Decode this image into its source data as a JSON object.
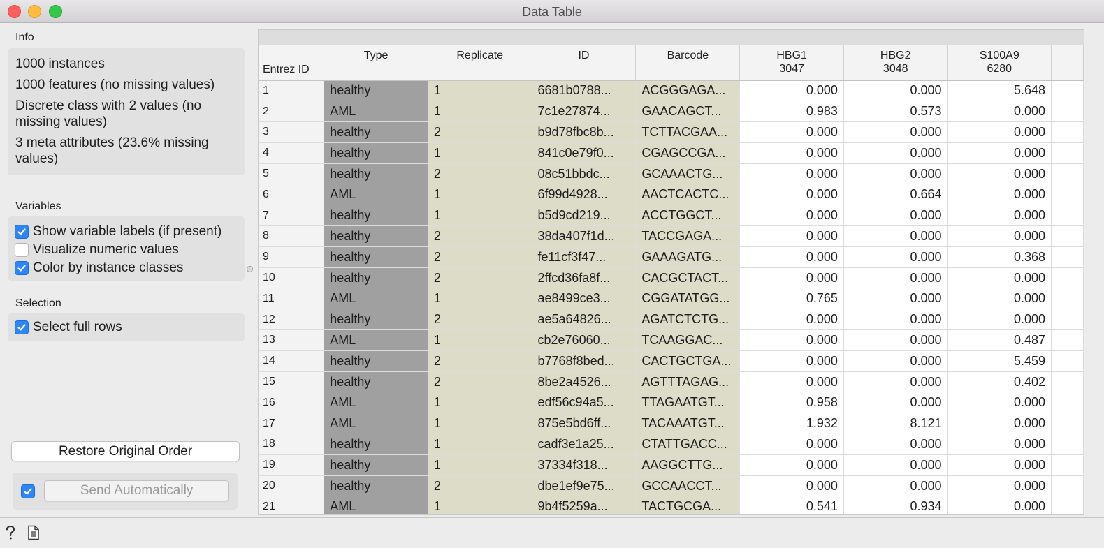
{
  "window": {
    "title": "Data Table"
  },
  "info": {
    "label": "Info",
    "lines": [
      "1000 instances",
      "1000 features (no missing values)",
      "Discrete class with 2 values (no",
      "missing values)",
      "3 meta attributes (23.6% missing",
      "values)"
    ]
  },
  "variables": {
    "label": "Variables",
    "options": [
      {
        "label": "Show variable labels (if present)",
        "checked": true
      },
      {
        "label": "Visualize numeric values",
        "checked": false
      },
      {
        "label": "Color by instance classes",
        "checked": true
      }
    ]
  },
  "selection": {
    "label": "Selection",
    "options": [
      {
        "label": "Select full rows",
        "checked": true
      }
    ]
  },
  "buttons": {
    "restore": "Restore Original Order",
    "send": "Send Automatically",
    "send_checked": true
  },
  "table": {
    "corner_label": "Entrez ID",
    "columns": [
      {
        "name": "Type",
        "sub": ""
      },
      {
        "name": "Replicate",
        "sub": ""
      },
      {
        "name": "ID",
        "sub": ""
      },
      {
        "name": "Barcode",
        "sub": ""
      },
      {
        "name": "HBG1",
        "sub": "3047"
      },
      {
        "name": "HBG2",
        "sub": "3048"
      },
      {
        "name": "S100A9",
        "sub": "6280"
      }
    ],
    "rows": [
      [
        "1",
        "healthy",
        "1",
        "6681b0788...",
        "ACGGGAGA...",
        "0.000",
        "0.000",
        "5.648"
      ],
      [
        "2",
        "AML",
        "1",
        "7c1e27874...",
        "GAACAGCT...",
        "0.983",
        "0.573",
        "0.000"
      ],
      [
        "3",
        "healthy",
        "2",
        "b9d78fbc8b...",
        "TCTTACGAA...",
        "0.000",
        "0.000",
        "0.000"
      ],
      [
        "4",
        "healthy",
        "1",
        "841c0e79f0...",
        "CGAGCCGA...",
        "0.000",
        "0.000",
        "0.000"
      ],
      [
        "5",
        "healthy",
        "2",
        "08c51bbdc...",
        "GCAAACTG...",
        "0.000",
        "0.000",
        "0.000"
      ],
      [
        "6",
        "AML",
        "1",
        "6f99d4928...",
        "AACTCACTC...",
        "0.000",
        "0.664",
        "0.000"
      ],
      [
        "7",
        "healthy",
        "1",
        "b5d9cd219...",
        "ACCTGGCT...",
        "0.000",
        "0.000",
        "0.000"
      ],
      [
        "8",
        "healthy",
        "2",
        "38da407f1d...",
        "TACCGAGA...",
        "0.000",
        "0.000",
        "0.000"
      ],
      [
        "9",
        "healthy",
        "2",
        "fe11cf3f47...",
        "GAAAGATG...",
        "0.000",
        "0.000",
        "0.368"
      ],
      [
        "10",
        "healthy",
        "2",
        "2ffcd36fa8f...",
        "CACGCTACT...",
        "0.000",
        "0.000",
        "0.000"
      ],
      [
        "11",
        "AML",
        "1",
        "ae8499ce3...",
        "CGGATATGG...",
        "0.765",
        "0.000",
        "0.000"
      ],
      [
        "12",
        "healthy",
        "2",
        "ae5a64826...",
        "AGATCTCTG...",
        "0.000",
        "0.000",
        "0.000"
      ],
      [
        "13",
        "AML",
        "1",
        "cb2e76060...",
        "TCAAGGAC...",
        "0.000",
        "0.000",
        "0.487"
      ],
      [
        "14",
        "healthy",
        "2",
        "b7768f8bed...",
        "CACTGCTGA...",
        "0.000",
        "0.000",
        "5.459"
      ],
      [
        "15",
        "healthy",
        "2",
        "8be2a4526...",
        "AGTTTAGAG...",
        "0.000",
        "0.000",
        "0.402"
      ],
      [
        "16",
        "AML",
        "1",
        "edf56c94a5...",
        "TTAGAATGT...",
        "0.958",
        "0.000",
        "0.000"
      ],
      [
        "17",
        "AML",
        "1",
        "875e5bd6ff...",
        "TACAAATGT...",
        "1.932",
        "8.121",
        "0.000"
      ],
      [
        "18",
        "healthy",
        "1",
        "cadf3e1a25...",
        "CTATTGACC...",
        "0.000",
        "0.000",
        "0.000"
      ],
      [
        "19",
        "healthy",
        "1",
        "37334f318...",
        "AAGGCTTG...",
        "0.000",
        "0.000",
        "0.000"
      ],
      [
        "20",
        "healthy",
        "2",
        "dbe1ef9e75...",
        "GCCAACCT...",
        "0.000",
        "0.000",
        "0.000"
      ],
      [
        "21",
        "AML",
        "1",
        "9b4f5259a...",
        "TACTGCGA...",
        "0.541",
        "0.934",
        "0.000"
      ]
    ]
  },
  "colors": {
    "class_cell": "#a0a0a0",
    "meta_cell": "#dcdcc8",
    "checkbox": "#2d85f7"
  }
}
